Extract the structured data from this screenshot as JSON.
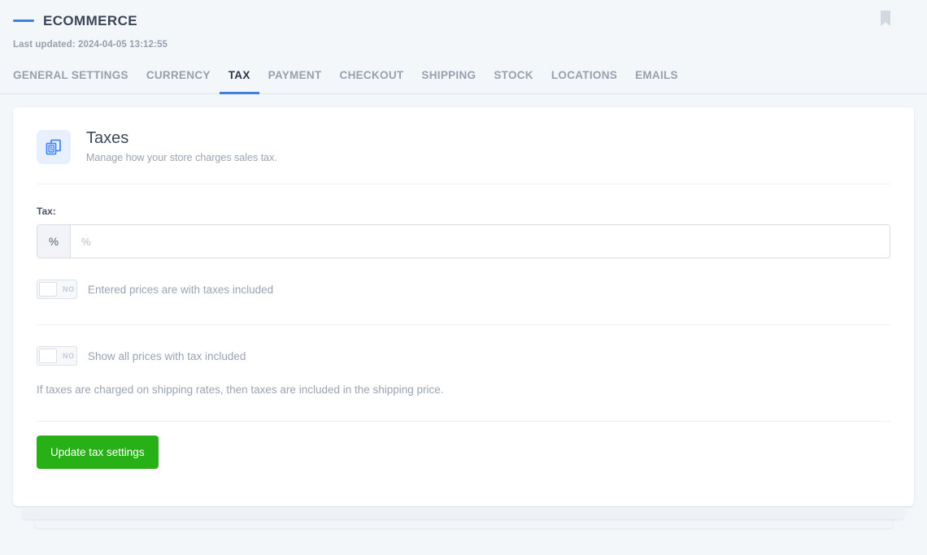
{
  "header": {
    "title": "ECOMMERCE",
    "last_updated": "Last updated: 2024-04-05 13:12:55",
    "bookmark_icon": "bookmark-icon",
    "brand_accent": "#3f7fe0"
  },
  "tabs": [
    {
      "label": "GENERAL SETTINGS",
      "active": false
    },
    {
      "label": "CURRENCY",
      "active": false
    },
    {
      "label": "TAX",
      "active": true
    },
    {
      "label": "PAYMENT",
      "active": false
    },
    {
      "label": "CHECKOUT",
      "active": false
    },
    {
      "label": "SHIPPING",
      "active": false
    },
    {
      "label": "STOCK",
      "active": false
    },
    {
      "label": "LOCATIONS",
      "active": false
    },
    {
      "label": "EMAILS",
      "active": false
    }
  ],
  "card": {
    "icon": "tax-receipt-icon",
    "title": "Taxes",
    "subtitle": "Manage how your store charges sales tax.",
    "tax_field": {
      "label": "Tax:",
      "addon": "%",
      "value": "",
      "placeholder": "%"
    },
    "toggles": [
      {
        "state_label": "NO",
        "checked": false,
        "label": "Entered prices are with taxes included"
      },
      {
        "state_label": "NO",
        "checked": false,
        "label": "Show all prices with tax included"
      }
    ],
    "helper_text": "If taxes are charged on shipping rates, then taxes are included in the shipping price.",
    "submit_label": "Update tax settings",
    "submit_color": "#28b117"
  }
}
